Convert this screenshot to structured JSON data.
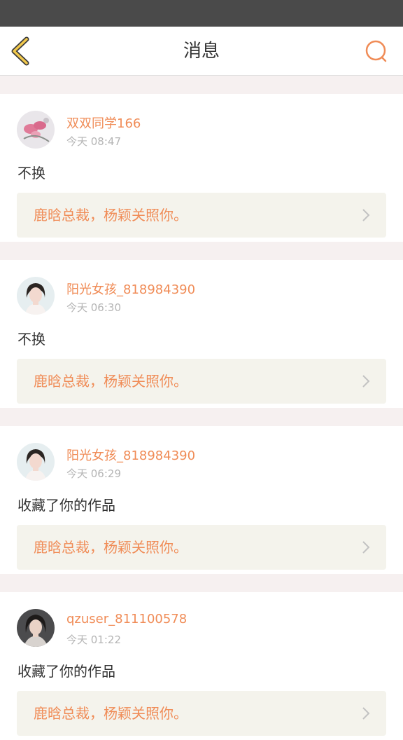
{
  "header": {
    "title": "消息",
    "back_icon": "chevron-left-icon",
    "search_icon": "search-icon",
    "accent_color": "#f08c57"
  },
  "messages": [
    {
      "username": "双双同学166",
      "time": "今天 08:47",
      "text": "不换",
      "quote": "鹿晗总裁，杨颖关照你。",
      "avatar": "lotus-avatar"
    },
    {
      "username": "阳光女孩_818984390",
      "time": "今天 06:30",
      "text": "不换",
      "quote": "鹿晗总裁，杨颖关照你。",
      "avatar": "woman-portrait-avatar"
    },
    {
      "username": "阳光女孩_818984390",
      "time": "今天 06:29",
      "text": "收藏了你的作品",
      "quote": "鹿晗总裁，杨颖关照你。",
      "avatar": "woman-portrait-avatar"
    },
    {
      "username": "qzuser_811100578",
      "time": "今天 01:22",
      "text": "收藏了你的作品",
      "quote": "鹿晗总裁，杨颖关照你。",
      "avatar": "woman-portrait-avatar"
    }
  ]
}
